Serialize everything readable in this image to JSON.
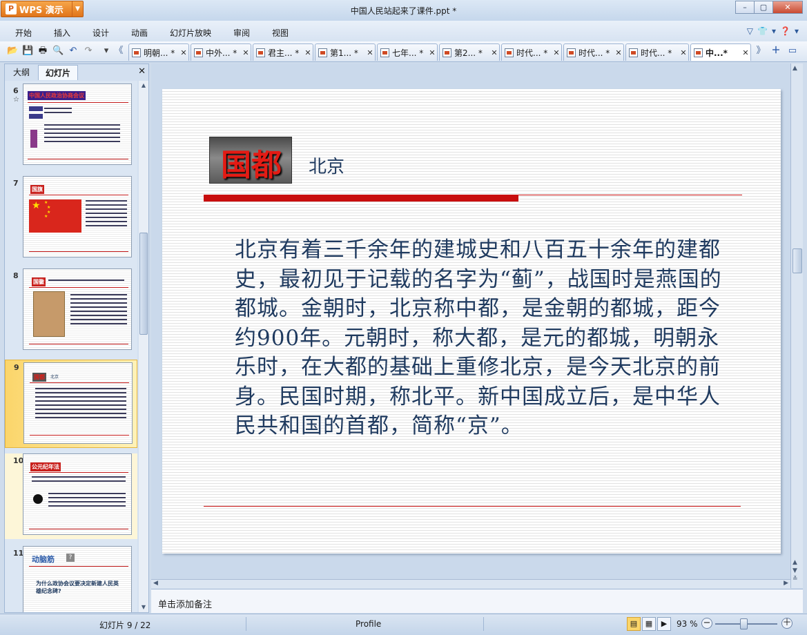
{
  "app": {
    "name": "WPS 演示",
    "window_title": "中国人民站起来了课件.ppt *"
  },
  "menu": [
    "开始",
    "插入",
    "设计",
    "动画",
    "幻灯片放映",
    "审阅",
    "视图"
  ],
  "doc_tabs": [
    "明朝... *",
    "中外... *",
    "君主... *",
    "第1... *",
    "七年... *",
    "第2... *",
    "时代... *",
    "时代... *",
    "时代... *",
    "中...*"
  ],
  "left_panel": {
    "tabs": [
      "大纲",
      "幻灯片"
    ],
    "thumbnails": [
      {
        "num": "6",
        "title": "中国人民政治协商会议"
      },
      {
        "num": "7",
        "title": "国旗"
      },
      {
        "num": "8",
        "title": "国徽"
      },
      {
        "num": "9",
        "title": "国都",
        "subtitle": "北京"
      },
      {
        "num": "10",
        "title": "公元纪年法"
      },
      {
        "num": "11",
        "title": "动脑筋",
        "subtitle": "为什么政协会议要决定新建人民英雄纪念碑?"
      }
    ]
  },
  "slide": {
    "title": "国都",
    "subtitle": "北京",
    "body": "北京有着三千余年的建城史和八百五十余年的建都史，最初见于记载的名字为“蓟”，战国时是燕国的都城。金朝时，北京称中都，是金朝的都城，距今约900年。元朝时，称大都，是元的都城，明朝永乐时，在大都的基础上重修北京，是今天北京的前身。民国时期，称北平。新中国成立后，是中华人民共和国的首都，简称“京”。"
  },
  "notes_placeholder": "单击添加备注",
  "status": {
    "slide_indicator": "幻灯片 9 / 22",
    "profile": "Profile",
    "zoom": "93 %"
  },
  "colors": {
    "accent_red": "#c80e0e",
    "body_text": "#1f3a5f",
    "wps_orange": "#e0741a"
  }
}
